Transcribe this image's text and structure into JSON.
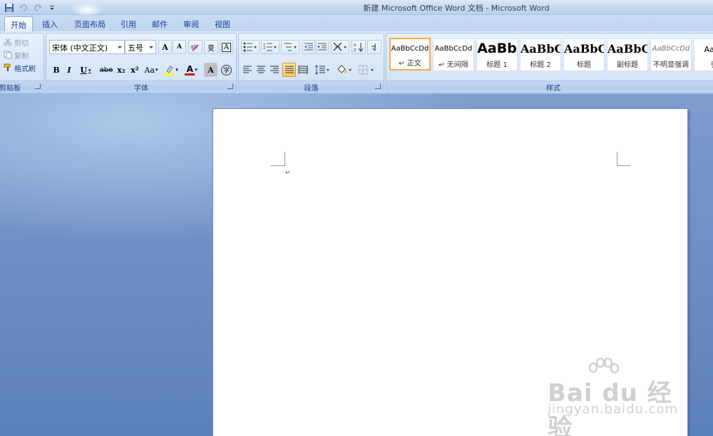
{
  "window": {
    "title": "新建 Microsoft Office Word 文档 - Microsoft Word"
  },
  "quick_access": [
    "save-icon",
    "undo-icon",
    "redo-icon",
    "customize-icon"
  ],
  "tabs": [
    {
      "label": "开始",
      "active": true
    },
    {
      "label": "插入"
    },
    {
      "label": "页面布局"
    },
    {
      "label": "引用"
    },
    {
      "label": "邮件"
    },
    {
      "label": "审阅"
    },
    {
      "label": "视图"
    }
  ],
  "clipboard": {
    "label": "剪贴板",
    "cut": "剪切",
    "copy": "复制",
    "format_painter": "格式刷"
  },
  "font": {
    "label": "字体",
    "font_name": "宋体 (中文正文)",
    "font_size": "五号",
    "bold": "B",
    "italic": "I",
    "underline": "U",
    "strikethrough": "abe",
    "subscript": "x₂",
    "superscript": "x²",
    "change_case": "Aa",
    "font_color_letter": "A",
    "char_shading": "A",
    "grow": "A",
    "shrink": "A",
    "char_border": "A",
    "phonetic": "变",
    "enclose": "字"
  },
  "paragraph": {
    "label": "段落"
  },
  "styles": {
    "label": "样式",
    "items": [
      {
        "sample": "AaBbCcDd",
        "name": "↵ 正文",
        "selected": true
      },
      {
        "sample": "AaBbCcDd",
        "name": "↵ 无间隔"
      },
      {
        "sample": "AaBb",
        "name": "标题 1"
      },
      {
        "sample": "AaBbC",
        "name": "标题 2"
      },
      {
        "sample": "AaBbC",
        "name": "标题"
      },
      {
        "sample": "AaBbC",
        "name": "副标题"
      },
      {
        "sample": "AaBbCcDd",
        "name": "不明显强调"
      },
      {
        "sample": "AaBb",
        "name": "强"
      }
    ]
  },
  "document": {
    "paragraph_mark": "↵"
  },
  "watermark": {
    "brand": "Bai du 经验",
    "url": "jingyan.baidu.com"
  },
  "colors": {
    "accent_highlight": "#f8c866",
    "font_color_bar": "#e00000",
    "highlight_bar": "#ffff00"
  }
}
